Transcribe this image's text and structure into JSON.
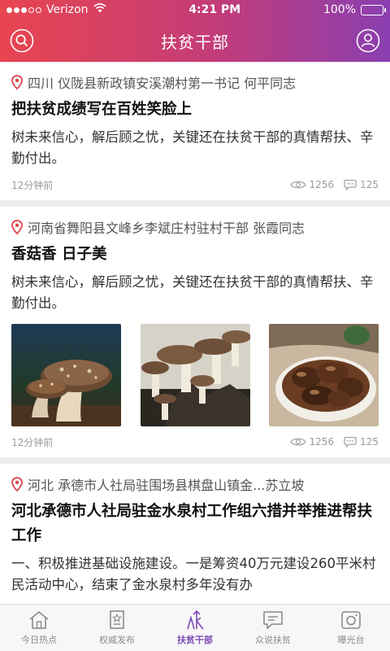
{
  "status": {
    "carrier": "Verizon",
    "time": "4:21 PM",
    "battery": "100%",
    "battery_level": 1.0
  },
  "header": {
    "title": "扶贫干部",
    "search_icon": "search-icon",
    "profile_icon": "user-icon"
  },
  "feed": [
    {
      "location": "四川 仪陇县新政镇安溪潮村第一书记 何平同志",
      "title": "把扶贫成绩写在百姓笑脸上",
      "summary": "树未来信心，解后顾之忧，关键还在扶贫干部的真情帮扶、辛勤付出。",
      "time": "12分钟前",
      "views": "1256",
      "comments": "125"
    },
    {
      "location": "河南省舞阳县文峰乡李斌庄村驻村干部 张霞同志",
      "title": "香菇香 日子美",
      "summary": "树未来信心，解后顾之忧，关键还在扶贫干部的真情帮扶、辛勤付出。",
      "images": [
        "mushroom-growing-photo",
        "mushroom-log-photo",
        "mushroom-bowl-photo"
      ],
      "time": "12分钟前",
      "views": "1256",
      "comments": "125"
    },
    {
      "location": "河北 承德市人社局驻围场县棋盘山镇金...苏立坡",
      "title": "河北承德市人社局驻金水泉村工作组六措并举推进帮扶工作",
      "summary": "一、积极推进基础设施建设。一是筹资40万元建设260平米村民活动中心，结束了金水泉村多年没有办"
    }
  ],
  "tabs": [
    {
      "label": "今日热点",
      "icon": "home-icon",
      "active": false
    },
    {
      "label": "权威发布",
      "icon": "badge-icon",
      "active": false
    },
    {
      "label": "扶贫干部",
      "icon": "cadre-icon",
      "active": true
    },
    {
      "label": "众说扶贫",
      "icon": "chat-icon",
      "active": false
    },
    {
      "label": "曝光台",
      "icon": "camera-icon",
      "active": false
    }
  ],
  "colors": {
    "accent": "#7d4bb5",
    "gradient_start": "#e8454f",
    "gradient_end": "#8a3fb0",
    "pin": "#e0434b"
  }
}
